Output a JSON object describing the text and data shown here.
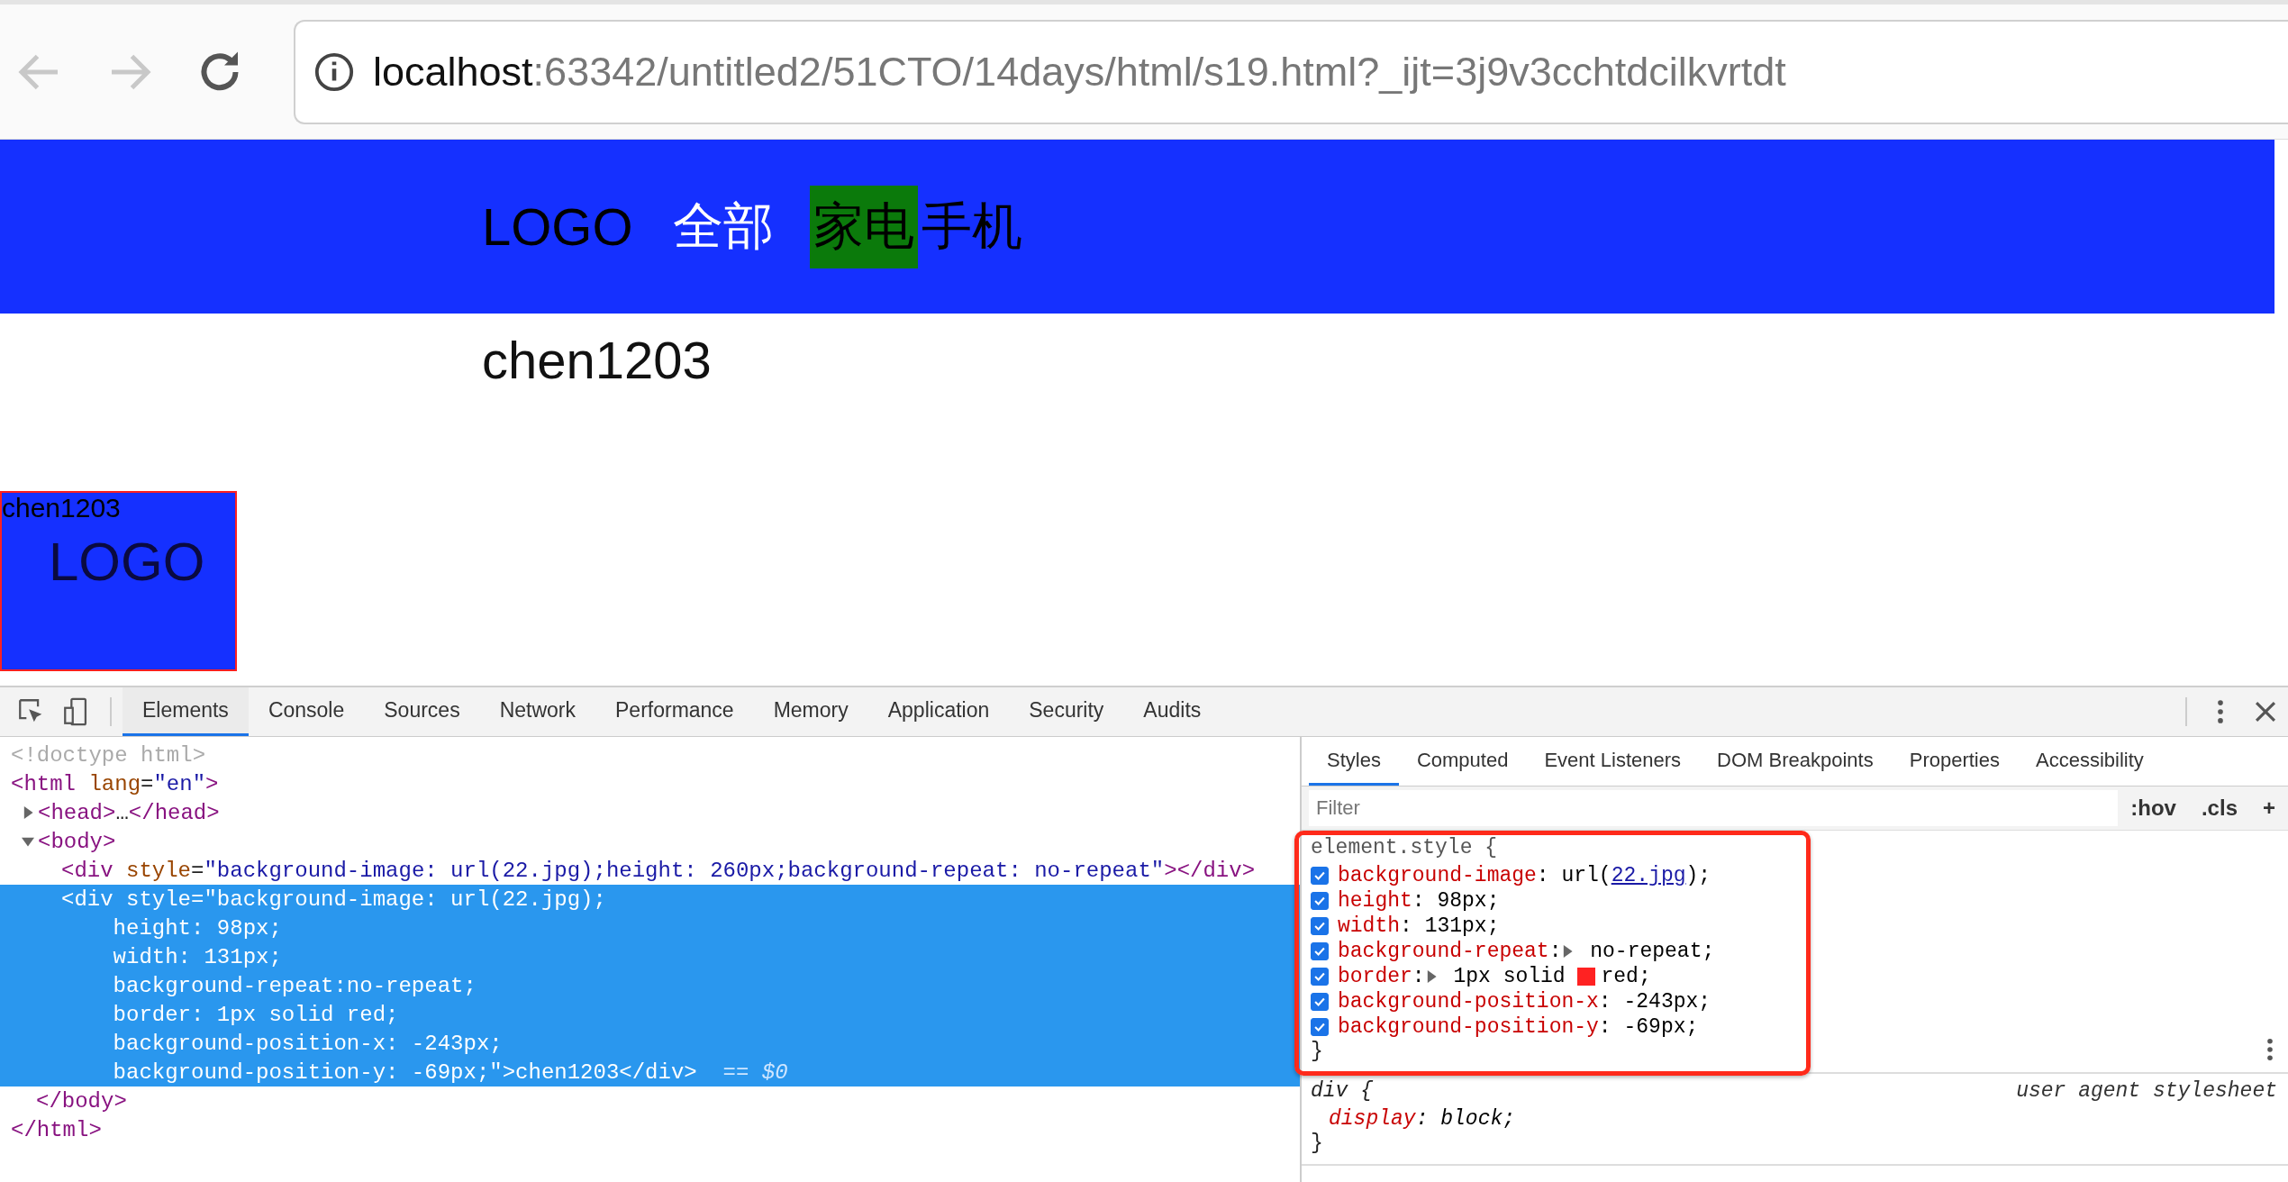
{
  "browser": {
    "url": {
      "host": "localhost",
      "rest": ":63342/untitled2/51CTO/14days/html/s19.html?_ijt=3j9v3cchtdcilkvrtdt"
    }
  },
  "page": {
    "nav": {
      "logo": "LOGO",
      "items": [
        {
          "label": "全部",
          "selected": false,
          "color": "#ffffff"
        },
        {
          "label": "家电",
          "selected": true,
          "color": "#000000"
        },
        {
          "label": "手机",
          "selected": false,
          "color": "#000000"
        }
      ]
    },
    "text": "chen1203",
    "sprite_box": {
      "text": "chen1203",
      "logo": "LOGO"
    }
  },
  "devtools": {
    "tabs": [
      {
        "label": "Elements",
        "selected": true
      },
      {
        "label": "Console",
        "selected": false
      },
      {
        "label": "Sources",
        "selected": false
      },
      {
        "label": "Network",
        "selected": false
      },
      {
        "label": "Performance",
        "selected": false
      },
      {
        "label": "Memory",
        "selected": false
      },
      {
        "label": "Application",
        "selected": false
      },
      {
        "label": "Security",
        "selected": false
      },
      {
        "label": "Audits",
        "selected": false
      }
    ],
    "dom": [
      {
        "kind": "doctype",
        "lines": [
          "<!doctype html>"
        ],
        "selected": false
      },
      {
        "kind": "element",
        "lines": [
          "<html lang=\"en\">"
        ],
        "selected": false,
        "children": [
          {
            "kind": "element",
            "lines": [
              "<head>…</head>"
            ],
            "expanded": false,
            "selected": false
          },
          {
            "kind": "element",
            "lines": [
              "<body>"
            ],
            "expanded": true,
            "selected": false,
            "children": [
              {
                "kind": "element",
                "lines": [
                  "<div style=\"background-image: url(22.jpg);height: 260px;background-repeat: no-repeat\"></div>"
                ],
                "selected": false
              },
              {
                "kind": "element",
                "selected": true,
                "marker": "== $0",
                "lines": [
                  "<div style=\"background-image: url(22.jpg);",
                  "    height: 98px;",
                  "    width: 131px;",
                  "    background-repeat:no-repeat;",
                  "    border: 1px solid red;",
                  "    background-position-x: -243px;",
                  "    background-position-y: -69px;\">chen1203</div>"
                ]
              }
            ]
          },
          {
            "kind": "element",
            "lines": [
              "</body>"
            ],
            "selected": false
          }
        ]
      },
      {
        "kind": "element",
        "lines": [
          "</html>"
        ],
        "selected": false
      }
    ],
    "side_tabs": [
      {
        "label": "Styles",
        "selected": true
      },
      {
        "label": "Computed",
        "selected": false
      },
      {
        "label": "Event Listeners",
        "selected": false
      },
      {
        "label": "DOM Breakpoints",
        "selected": false
      },
      {
        "label": "Properties",
        "selected": false
      },
      {
        "label": "Accessibility",
        "selected": false
      }
    ],
    "filter": {
      "placeholder": "Filter"
    },
    "filter_buttons": [
      ":hov",
      ".cls",
      "+"
    ],
    "rules": [
      {
        "selector": "element.style {",
        "highlighted": true,
        "close": "}",
        "declarations": [
          {
            "property": "background-image",
            "sep": ":",
            "before": " url(",
            "link": "22.jpg",
            "after": ");",
            "checked": true
          },
          {
            "property": "height",
            "sep": ":",
            "before": " 98px;",
            "checked": true
          },
          {
            "property": "width",
            "sep": ":",
            "before": " 131px;",
            "checked": true
          },
          {
            "property": "background-repeat",
            "sep": ":",
            "before": " no-repeat;",
            "checked": true,
            "expandable": true
          },
          {
            "property": "border",
            "sep": ":",
            "before": " 1px solid ",
            "color": "#ff2222",
            "after": "red;",
            "checked": true,
            "expandable": true
          },
          {
            "property": "background-position-x",
            "sep": ":",
            "before": " -243px;",
            "checked": true
          },
          {
            "property": "background-position-y",
            "sep": ":",
            "before": " -69px;",
            "checked": true
          }
        ]
      },
      {
        "selector": "div {",
        "origin": "user agent stylesheet",
        "close": "}",
        "declarations": [
          {
            "property": "display",
            "sep": ":",
            "before": " block;",
            "italic": true
          }
        ]
      }
    ]
  }
}
